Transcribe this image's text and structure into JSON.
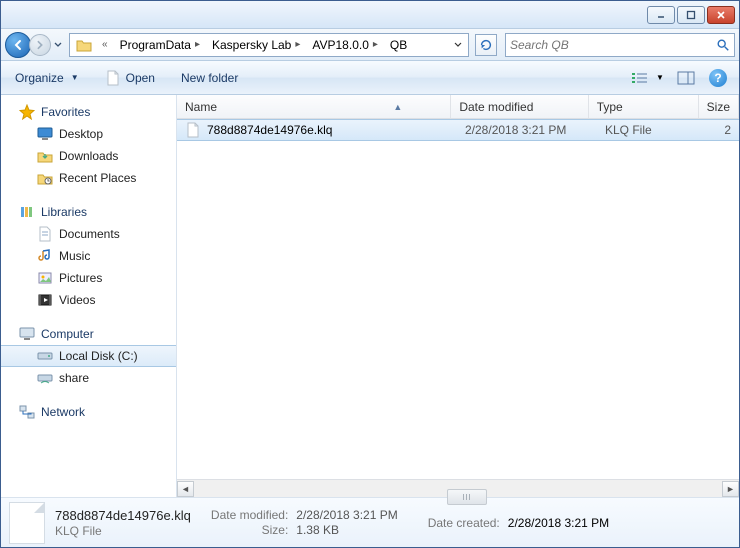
{
  "breadcrumb": {
    "items": [
      "ProgramData",
      "Kaspersky Lab",
      "AVP18.0.0",
      "QB"
    ]
  },
  "search": {
    "placeholder": "Search QB"
  },
  "toolbar": {
    "organize": "Organize",
    "open": "Open",
    "newfolder": "New folder"
  },
  "sidebar": {
    "favorites": {
      "label": "Favorites",
      "items": [
        "Desktop",
        "Downloads",
        "Recent Places"
      ]
    },
    "libraries": {
      "label": "Libraries",
      "items": [
        "Documents",
        "Music",
        "Pictures",
        "Videos"
      ]
    },
    "computer": {
      "label": "Computer",
      "items": [
        "Local Disk (C:)",
        "share"
      ]
    },
    "network": {
      "label": "Network"
    }
  },
  "columns": {
    "name": "Name",
    "date": "Date modified",
    "type": "Type",
    "size": "Size"
  },
  "files": [
    {
      "name": "788d8874de14976e.klq",
      "date": "2/28/2018 3:21 PM",
      "type": "KLQ File",
      "size": "2"
    }
  ],
  "details": {
    "filename": "788d8874de14976e.klq",
    "filetype": "KLQ File",
    "modified_label": "Date modified:",
    "modified": "2/28/2018 3:21 PM",
    "size_label": "Size:",
    "size": "1.38 KB",
    "created_label": "Date created:",
    "created": "2/28/2018 3:21 PM"
  }
}
